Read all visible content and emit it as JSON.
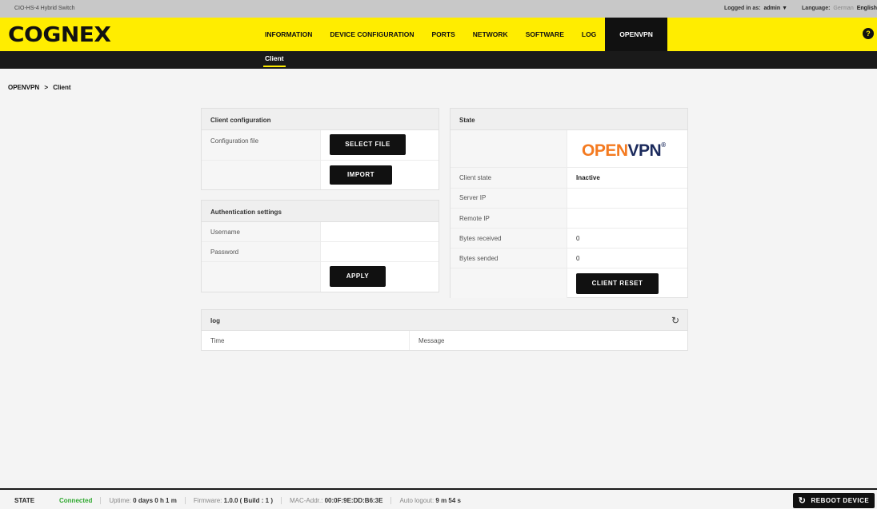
{
  "topbar": {
    "device_name": "CIO-HS-4 Hybrid Switch",
    "logged_in_label": "Logged in as:",
    "user": "admin",
    "user_caret": "▼",
    "language_label": "Language:",
    "languages": [
      "German",
      "English"
    ],
    "selected_language": "English"
  },
  "brand": {
    "logo_text": "COGNEX",
    "color": "#ffed00"
  },
  "nav": {
    "items": [
      "INFORMATION",
      "DEVICE CONFIGURATION",
      "PORTS",
      "NETWORK",
      "SOFTWARE",
      "LOG",
      "OPENVPN"
    ],
    "active": "OPENVPN"
  },
  "subnav": {
    "items": [
      "Client"
    ],
    "active": "Client"
  },
  "breadcrumb": {
    "parts": [
      "OPENVPN",
      "Client"
    ],
    "separator": ">"
  },
  "client_config": {
    "title": "Client configuration",
    "config_file_label": "Configuration file",
    "select_file_button": "SELECT FILE",
    "import_button": "IMPORT"
  },
  "auth": {
    "title": "Authentication settings",
    "username_label": "Username",
    "username_value": "",
    "password_label": "Password",
    "password_value": "",
    "apply_button": "APPLY"
  },
  "state": {
    "title": "State",
    "logo": {
      "o_glyph": "O",
      "open": "PEN",
      "vpn": "VPN",
      "reg": "®",
      "color": "#f47a20"
    },
    "rows": [
      {
        "label": "Client state",
        "value": "Inactive"
      },
      {
        "label": "Server IP",
        "value": ""
      },
      {
        "label": "Remote IP",
        "value": ""
      },
      {
        "label": "Bytes received",
        "value": "0"
      },
      {
        "label": "Bytes sended",
        "value": "0"
      }
    ],
    "reset_button": "CLIENT RESET"
  },
  "log": {
    "title": "log",
    "refresh_icon": "refresh-icon",
    "columns": [
      "Time",
      "Message"
    ]
  },
  "status": {
    "label": "STATE",
    "connection": "Connected",
    "uptime_label": "Uptime:",
    "uptime_value": "0 days 0 h 1 m",
    "firmware_label": "Firmware:",
    "firmware_value": "1.0.0 ( Build : 1 )",
    "mac_label": "MAC-Addr.:",
    "mac_value": "00:0F:9E:DD:B6:3E",
    "logout_label": "Auto logout:",
    "logout_value": "9 m 54 s",
    "reboot_button": "REBOOT DEVICE"
  }
}
